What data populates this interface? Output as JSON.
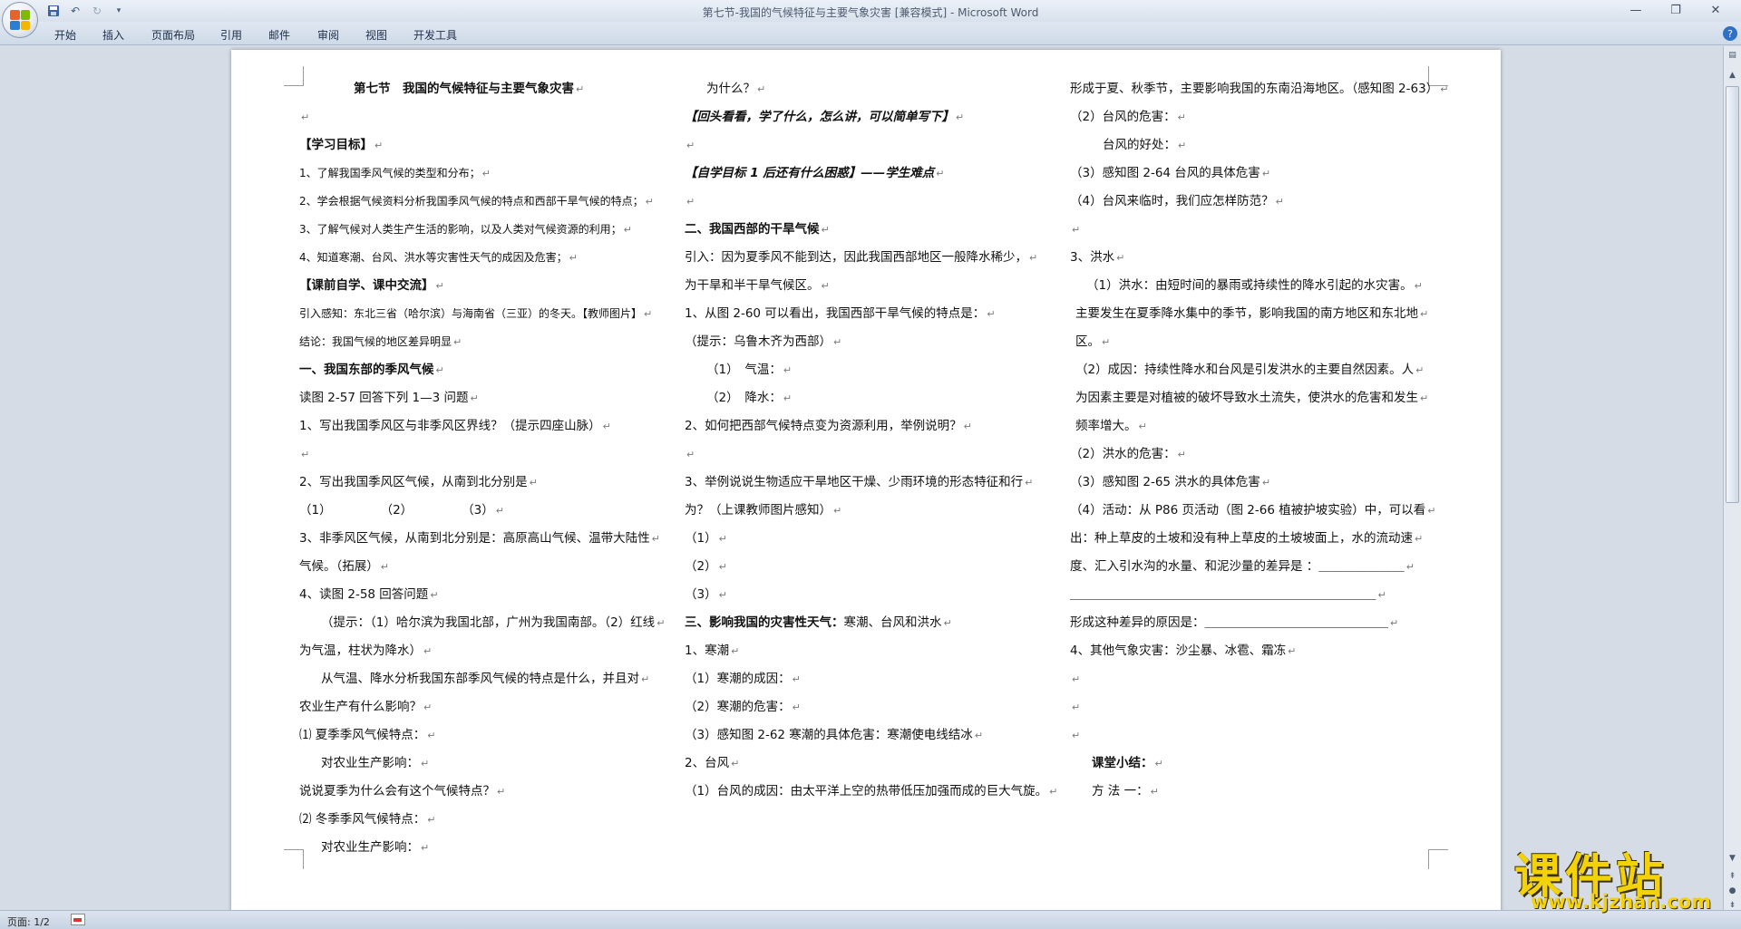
{
  "app": {
    "window_title": "第七节-我国的气候特征与主要气象灾害 [兼容模式] - Microsoft Word"
  },
  "ribbon": {
    "tabs": [
      "开始",
      "插入",
      "页面布局",
      "引用",
      "邮件",
      "审阅",
      "视图",
      "开发工具"
    ]
  },
  "statusbar": {
    "page": "页面: 1/2"
  },
  "watermark": {
    "main": "课件站",
    "url": "www.kjzhan.com"
  },
  "document": {
    "col1": [
      {
        "t": "第七节　我国的气候特征与主要气象灾害",
        "b": true,
        "indent": 60
      },
      {
        "t": ""
      },
      {
        "t": "【学习目标】",
        "b": true
      },
      {
        "t": "1、了解我国季风气候的类型和分布；",
        "small": true
      },
      {
        "t": "2、学会根据气候资料分析我国季风气候的特点和西部干旱气候的特点；",
        "small": true
      },
      {
        "t": "3、了解气候对人类生产生活的影响，以及人类对气候资源的利用；",
        "small": true
      },
      {
        "t": "4、知道寒潮、台风、洪水等灾害性天气的成因及危害；",
        "small": true
      },
      {
        "t": "【课前自学、课中交流】",
        "b": true
      },
      {
        "t": "引入感知：东北三省（哈尔滨）与海南省（三亚）的冬天。【教师图片】",
        "small": true
      },
      {
        "t": "结论：我国气候的地区差异明显",
        "small": true
      },
      {
        "t": "一、我国东部的季风气候",
        "b": true
      },
      {
        "t": "读图 2-57 回答下列 1—3 问题"
      },
      {
        "t": "1、写出我国季风区与非季风区界线？（提示四座山脉）"
      },
      {
        "t": ""
      },
      {
        "t": "2、写出我国季风区气候，从南到北分别是"
      },
      {
        "t": "（1）　　　　　（2）　　　　　（3）"
      },
      {
        "t": "3、非季风区气候，从南到北分别是：高原高山气候、温带大陆性"
      },
      {
        "t": "气候。（拓展）"
      },
      {
        "t": "4、读图 2-58 回答问题"
      },
      {
        "t": "（提示：（1）哈尔滨为我国北部，广州为我国南部。（2）红线",
        "indent": 24
      },
      {
        "t": "为气温，柱状为降水）"
      },
      {
        "t": "从气温、降水分析我国东部季风气候的特点是什么，并且对",
        "indent": 24
      },
      {
        "t": "农业生产有什么影响？"
      },
      {
        "t": "⑴ 夏季季风气候特点："
      },
      {
        "t": "对农业生产影响：",
        "indent": 24
      },
      {
        "t": "说说夏季为什么会有这个气候特点？"
      },
      {
        "t": "⑵ 冬季季风气候特点："
      },
      {
        "t": "对农业生产影响：",
        "indent": 24
      }
    ],
    "col2": [
      {
        "t": "为什么？",
        "indent": 24
      },
      {
        "t": "【回头看看，学了什么，怎么讲，可以简单写下】",
        "b": true,
        "i": true
      },
      {
        "t": ""
      },
      {
        "t": "【自学目标 1 后还有什么困惑】——学生难点",
        "b": true,
        "i": true
      },
      {
        "t": ""
      },
      {
        "t": "二、我国西部的干旱气候",
        "b": true
      },
      {
        "t": "引入：因为夏季风不能到达，因此我国西部地区一般降水稀少，"
      },
      {
        "t": "为干旱和半干旱气候区。"
      },
      {
        "t": "1、从图 2-60 可以看出，我国西部干旱气候的特点是："
      },
      {
        "t": "（提示：乌鲁木齐为西部）"
      },
      {
        "t": "（1）　气温：",
        "indent": 24
      },
      {
        "t": "（2）　降水：",
        "indent": 24
      },
      {
        "t": "2、如何把西部气候特点变为资源利用，举例说明？"
      },
      {
        "t": ""
      },
      {
        "t": "3、举例说说生物适应干旱地区干燥、少雨环境的形态特征和行"
      },
      {
        "t": "为？（上课教师图片感知）"
      },
      {
        "t": "（1）"
      },
      {
        "t": "（2）"
      },
      {
        "t": "（3）"
      },
      {
        "t": "三、影响我国的灾害性天气：",
        "b": true,
        "rest": "寒潮、台风和洪水"
      },
      {
        "t": "1、寒潮"
      },
      {
        "t": "（1）寒潮的成因："
      },
      {
        "t": "（2）寒潮的危害："
      },
      {
        "t": "（3）感知图 2-62 寒潮的具体危害：寒潮使电线结冰"
      },
      {
        "t": "2、台风"
      },
      {
        "t": "（1）台风的成因：由太平洋上空的热带低压加强而成的巨大气旋。"
      }
    ],
    "col3": [
      {
        "t": "形成于夏、秋季节，主要影响我国的东南沿海地区。（感知图 2-63）"
      },
      {
        "t": "（2）台风的危害："
      },
      {
        "t": "台风的好处：",
        "indent": 36
      },
      {
        "t": "（3）感知图 2-64 台风的具体危害"
      },
      {
        "t": "（4）台风来临时，我们应怎样防范？"
      },
      {
        "t": ""
      },
      {
        "t": "3、洪水"
      },
      {
        "t": "（1）洪水：由短时间的暴雨或持续性的降水引起的水灾害。",
        "indent": 18
      },
      {
        "t": "主要发生在夏季降水集中的季节，影响我国的南方地区和东北地",
        "indent": 6
      },
      {
        "t": "区。",
        "indent": 6
      },
      {
        "t": "（2）成因：持续性降水和台风是引发洪水的主要自然因素。人",
        "indent": 6
      },
      {
        "t": "为因素主要是对植被的破坏导致水土流失，使洪水的危害和发生",
        "indent": 6
      },
      {
        "t": "频率增大。",
        "indent": 6
      },
      {
        "t": "（2）洪水的危害："
      },
      {
        "t": "（3）感知图 2-65 洪水的具体危害"
      },
      {
        "t": "（4）活动：从 P86 页活动（图 2-66 植被护坡实验）中，可以看"
      },
      {
        "t": "出：种上草皮的土坡和没有种上草皮的土坡坡面上，水的流动速"
      },
      {
        "t": "度、汇入引水沟的水量、和泥沙量的差异是 ：＿＿＿＿＿＿＿"
      },
      {
        "t": "＿＿＿＿＿＿＿＿＿＿＿＿＿＿＿＿＿＿＿＿＿＿＿＿＿"
      },
      {
        "t": "形成这种差异的原因是：＿＿＿＿＿＿＿＿＿＿＿＿＿＿＿"
      },
      {
        "t": "4、其他气象灾害：沙尘暴、冰雹、霜冻"
      },
      {
        "t": ""
      },
      {
        "t": ""
      },
      {
        "t": ""
      },
      {
        "t": "课堂小结：",
        "b": true,
        "indent": 24
      },
      {
        "t": "方 法 一：",
        "indent": 24
      }
    ]
  }
}
